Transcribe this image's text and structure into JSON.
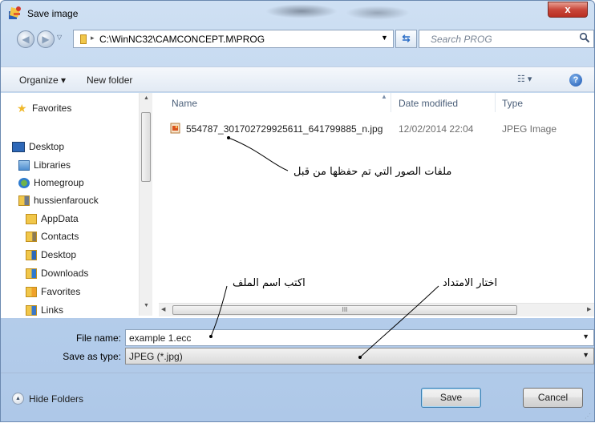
{
  "window": {
    "title": "Save image",
    "close_glyph": "x"
  },
  "address_bar": {
    "path": "C:\\WinNC32\\CAMCONCEPT.M\\PROG",
    "search_placeholder": "Search PROG"
  },
  "toolbar": {
    "organize_label": "Organize ▾",
    "new_folder_label": "New folder",
    "view_label": "☷ ▾",
    "help_label": "?"
  },
  "nav": {
    "items": [
      {
        "label": "Favorites",
        "icon": "star-icon"
      },
      {
        "label": "Desktop",
        "icon": "desktop-icon"
      },
      {
        "label": "Libraries",
        "icon": "libraries-icon"
      },
      {
        "label": "Homegroup",
        "icon": "homegroup-icon"
      },
      {
        "label": "hussienfarouck",
        "icon": "user-folder-icon"
      },
      {
        "label": "AppData",
        "icon": "folder-icon"
      },
      {
        "label": "Contacts",
        "icon": "contacts-folder-icon"
      },
      {
        "label": "Desktop",
        "icon": "desktop-folder-icon"
      },
      {
        "label": "Downloads",
        "icon": "downloads-folder-icon"
      },
      {
        "label": "Favorites",
        "icon": "favorites-folder-icon"
      },
      {
        "label": "Links",
        "icon": "links-folder-icon"
      }
    ]
  },
  "file_list": {
    "columns": [
      "Name",
      "Date modified",
      "Type"
    ],
    "files": [
      {
        "name": "554787_301702729925611_641799885_n.jpg",
        "date_modified": "12/02/2014 22:04",
        "type": "JPEG Image"
      }
    ],
    "hscroll_grip": "III"
  },
  "annotations": {
    "saved_images": "ملفات الصور التي تم حفظها من قبل",
    "write_filename": "اكتب اسم الملف",
    "choose_extension": "اختار الامتداد"
  },
  "form": {
    "file_name_label": "File name:",
    "file_name_value": "example 1.ecc",
    "save_type_label": "Save as type:",
    "save_type_value": "JPEG (*.jpg)"
  },
  "footer": {
    "hide_folders_label": "Hide Folders",
    "save_label": "Save",
    "cancel_label": "Cancel"
  },
  "colors": {
    "window_frame": "#bcd3ee",
    "close_button": "#c9473a",
    "link_blue": "#2b6ec7"
  }
}
